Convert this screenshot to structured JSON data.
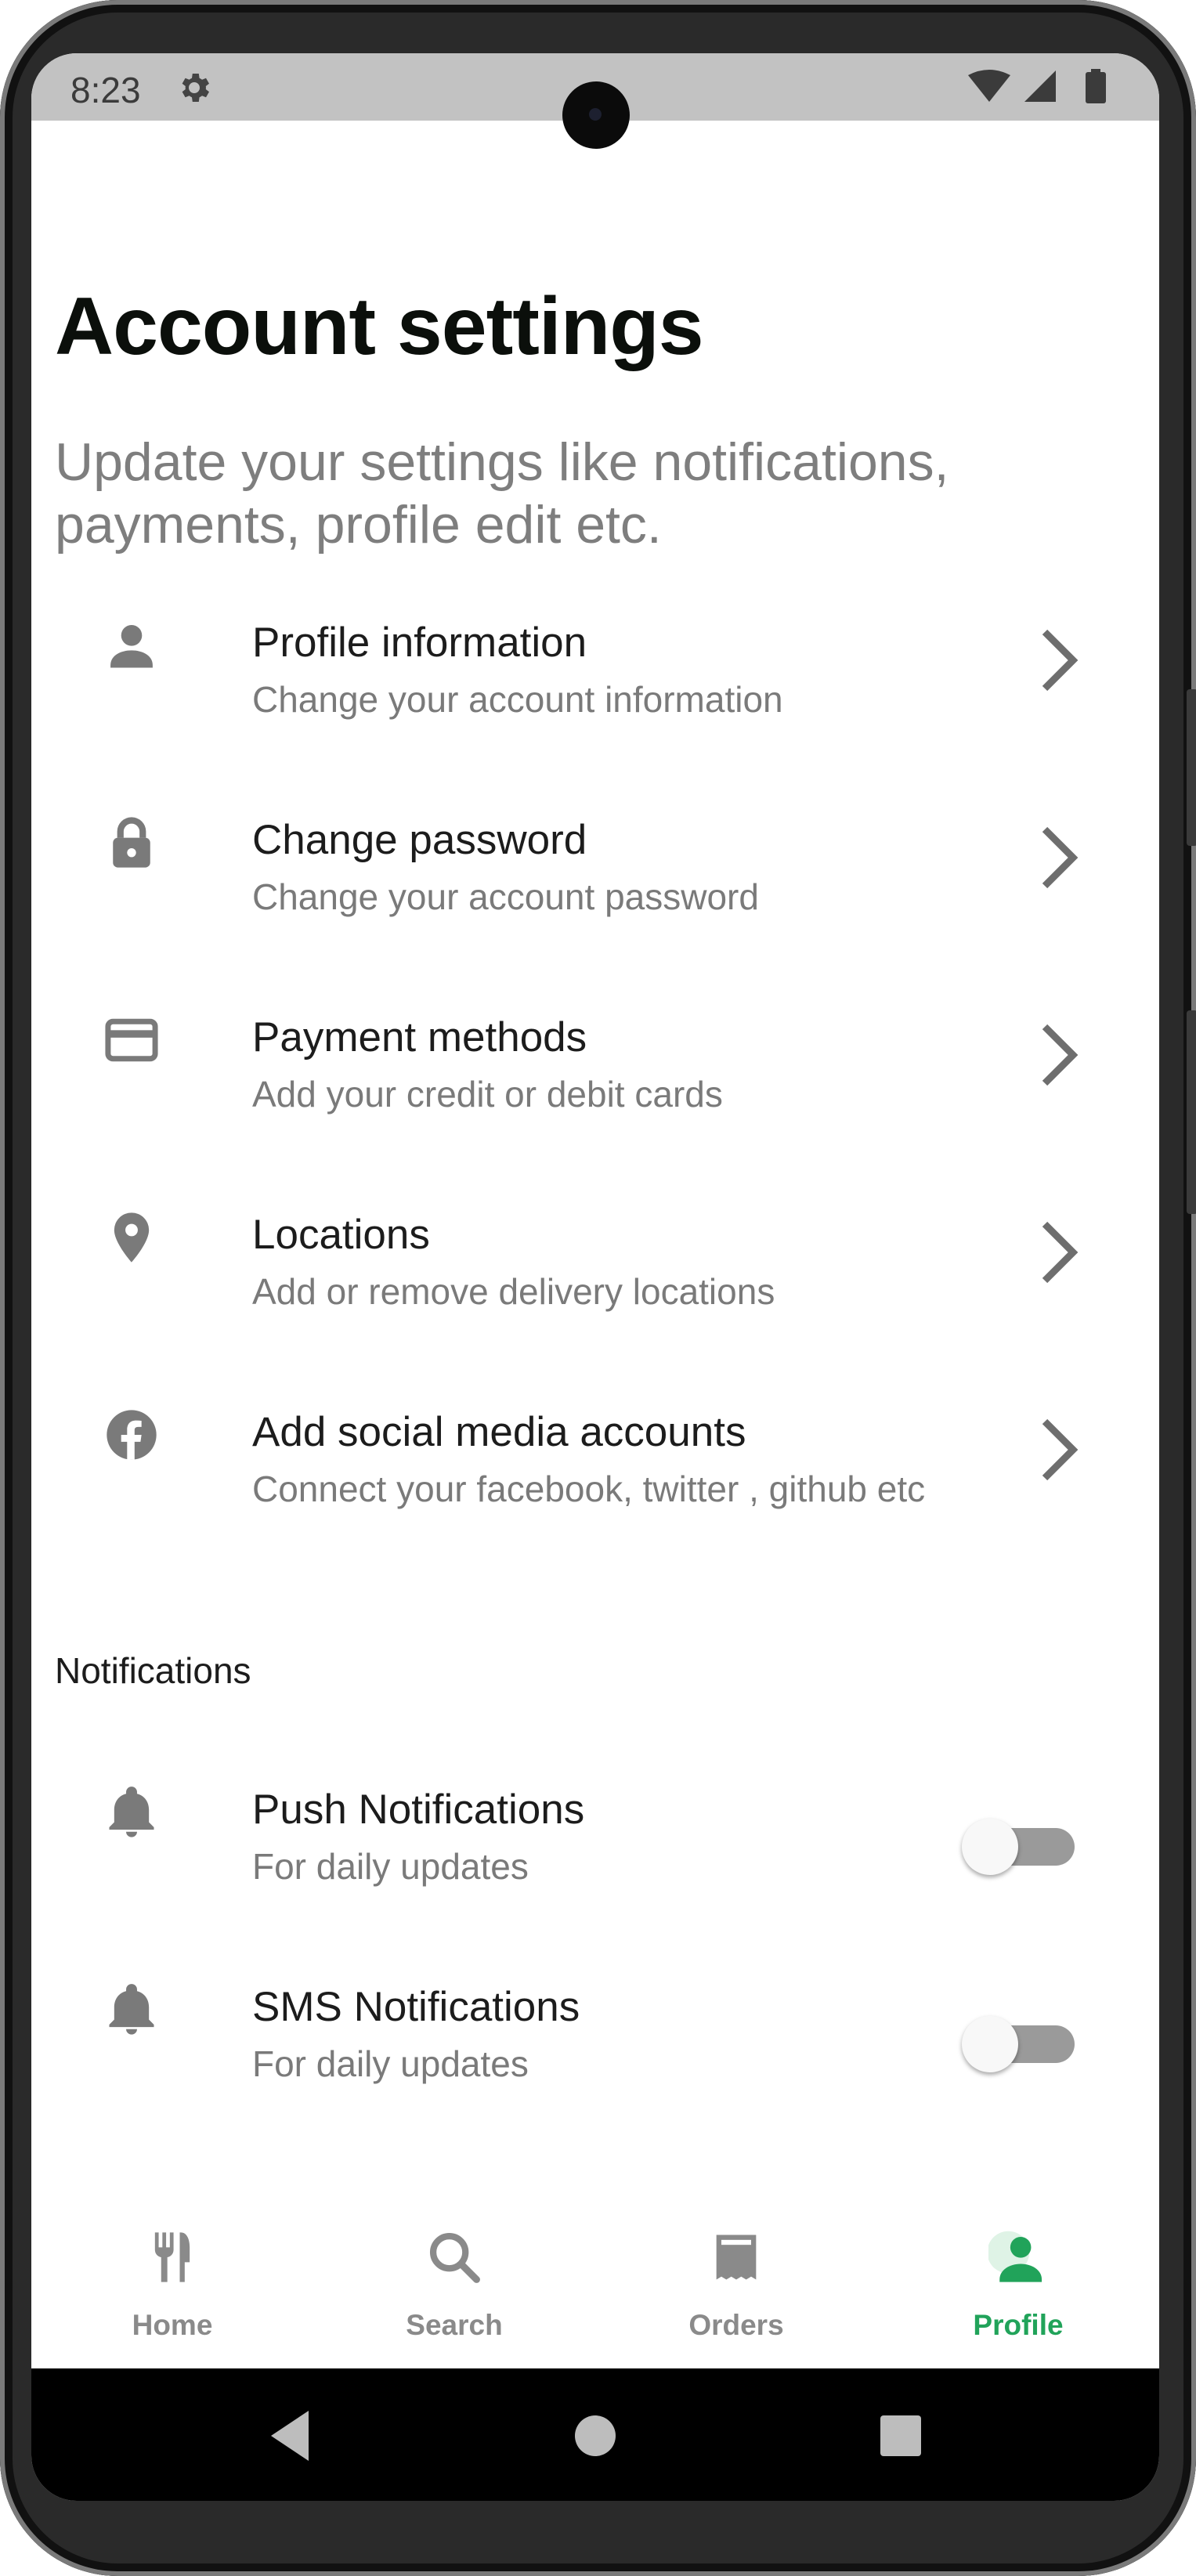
{
  "status_bar": {
    "time": "8:23",
    "icons": [
      "gear-icon",
      "wifi-icon",
      "signal-icon",
      "battery-icon"
    ]
  },
  "header": {
    "title": "Account settings",
    "subtitle": "Update your settings like notifications, payments, profile edit etc."
  },
  "settings": [
    {
      "icon": "person-icon",
      "title": "Profile information",
      "subtitle": "Change your account information"
    },
    {
      "icon": "lock-icon",
      "title": "Change password",
      "subtitle": "Change your account password"
    },
    {
      "icon": "credit-card-icon",
      "title": "Payment methods",
      "subtitle": "Add your credit or debit cards"
    },
    {
      "icon": "location-pin-icon",
      "title": "Locations",
      "subtitle": "Add or remove delivery locations"
    },
    {
      "icon": "facebook-icon",
      "title": "Add social media accounts",
      "subtitle": "Connect your facebook, twitter , github etc"
    }
  ],
  "notifications": {
    "section_label": "Notifications",
    "items": [
      {
        "icon": "bell-icon",
        "title": "Push Notifications",
        "subtitle": "For daily updates",
        "enabled": false
      },
      {
        "icon": "bell-icon",
        "title": "SMS Notifications",
        "subtitle": "For daily updates",
        "enabled": false
      }
    ]
  },
  "bottom_nav": {
    "items": [
      {
        "icon": "fork-knife-icon",
        "label": "Home",
        "active": false
      },
      {
        "icon": "search-icon",
        "label": "Search",
        "active": false
      },
      {
        "icon": "receipt-icon",
        "label": "Orders",
        "active": false
      },
      {
        "icon": "person-icon",
        "label": "Profile",
        "active": true
      }
    ]
  },
  "colors": {
    "accent": "#21a35a",
    "icon_gray": "#7a7a7a",
    "title_text": "#0b0f0b",
    "status_bar_bg": "#c2c2c2"
  }
}
